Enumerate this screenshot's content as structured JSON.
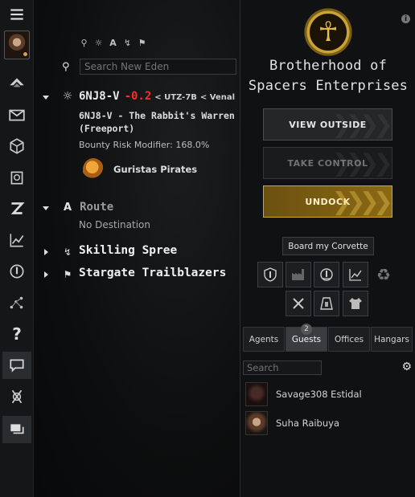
{
  "neocom": {
    "items": [
      {
        "name": "menu-icon"
      },
      {
        "name": "character-portrait"
      },
      {
        "name": "ship-fitting-icon"
      },
      {
        "name": "mail-icon"
      },
      {
        "name": "inventory-icon"
      },
      {
        "name": "industry-icon"
      },
      {
        "name": "z-icon"
      },
      {
        "name": "market-icon"
      },
      {
        "name": "agency-icon"
      },
      {
        "name": "map-icon"
      },
      {
        "name": "help-icon"
      },
      {
        "name": "chat-icon"
      },
      {
        "name": "alpha-icon"
      },
      {
        "name": "chat-channels-icon"
      }
    ]
  },
  "info_panel": {
    "search_placeholder": "Search New Eden",
    "location": {
      "system": "6NJ8-V",
      "security": "-0.2",
      "constellation": "< UTZ-7B",
      "region": "< Venal",
      "station": "6NJ8-V - The Rabbit's Warren (Freeport)",
      "bounty": "Bounty Risk Modifier: 168.0%",
      "faction": "Guristas Pirates"
    },
    "route": {
      "icon_letter": "A",
      "title": "Route",
      "subtitle": "No Destination"
    },
    "sections": [
      {
        "title": "Skilling Spree"
      },
      {
        "title": "Stargate Trailblazers"
      }
    ]
  },
  "station": {
    "corp_name_line1": "Brotherhood of",
    "corp_name_line2": "Spacers Enterprises",
    "info_label": "i",
    "btn_view": "VIEW OUTSIDE",
    "btn_take": "TAKE CONTROL",
    "btn_undock": "UNDOCK",
    "corvette": "Board my Corvette",
    "tabs": [
      {
        "label": "Agents"
      },
      {
        "label": "Guests",
        "count": "2"
      },
      {
        "label": "Offices"
      },
      {
        "label": "Hangars"
      }
    ],
    "guest_search_placeholder": "Search",
    "guests": [
      {
        "name": "Savage308 Estidal"
      },
      {
        "name": "Suha Raibuya"
      }
    ]
  },
  "colors": {
    "accent_gold": "#d4a42c",
    "security_red": "#ff2a2a"
  }
}
